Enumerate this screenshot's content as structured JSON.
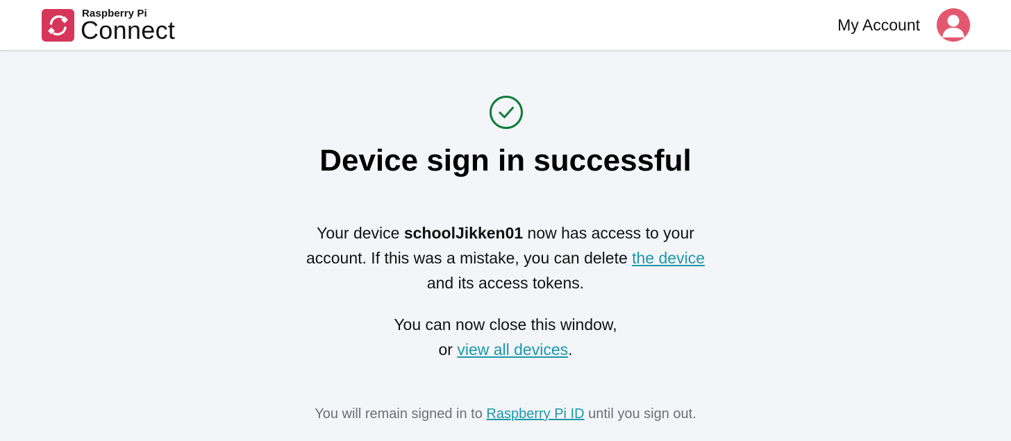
{
  "header": {
    "logo": {
      "brand_line1": "Raspberry Pi",
      "brand_line2": "Connect",
      "icon": "connect-logo-icon"
    },
    "account_label": "My Account",
    "avatar_icon": "user-avatar-icon"
  },
  "main": {
    "status_icon": "check-circle-icon",
    "title": "Device sign in successful",
    "message": {
      "before_device": "Your device ",
      "device_name": "schoolJikken01",
      "after_device": " now has access to your account. If this was a mistake, you can delete ",
      "delete_link": "the device",
      "after_link": " and its access tokens."
    },
    "close": {
      "line1": "You can now close this window,",
      "or_text": "or ",
      "devices_link": "view all devices",
      "period": "."
    },
    "footer": {
      "before_link": "You will remain signed in to ",
      "id_link": "Raspberry Pi ID",
      "after_link": " until you sign out."
    }
  },
  "colors": {
    "brand": "#d6365a",
    "avatar": "#e35870",
    "success": "#0c7c3a",
    "link": "#1b98ab",
    "page_background": "#f4f5f8",
    "muted_text": "#6b6f7a"
  }
}
